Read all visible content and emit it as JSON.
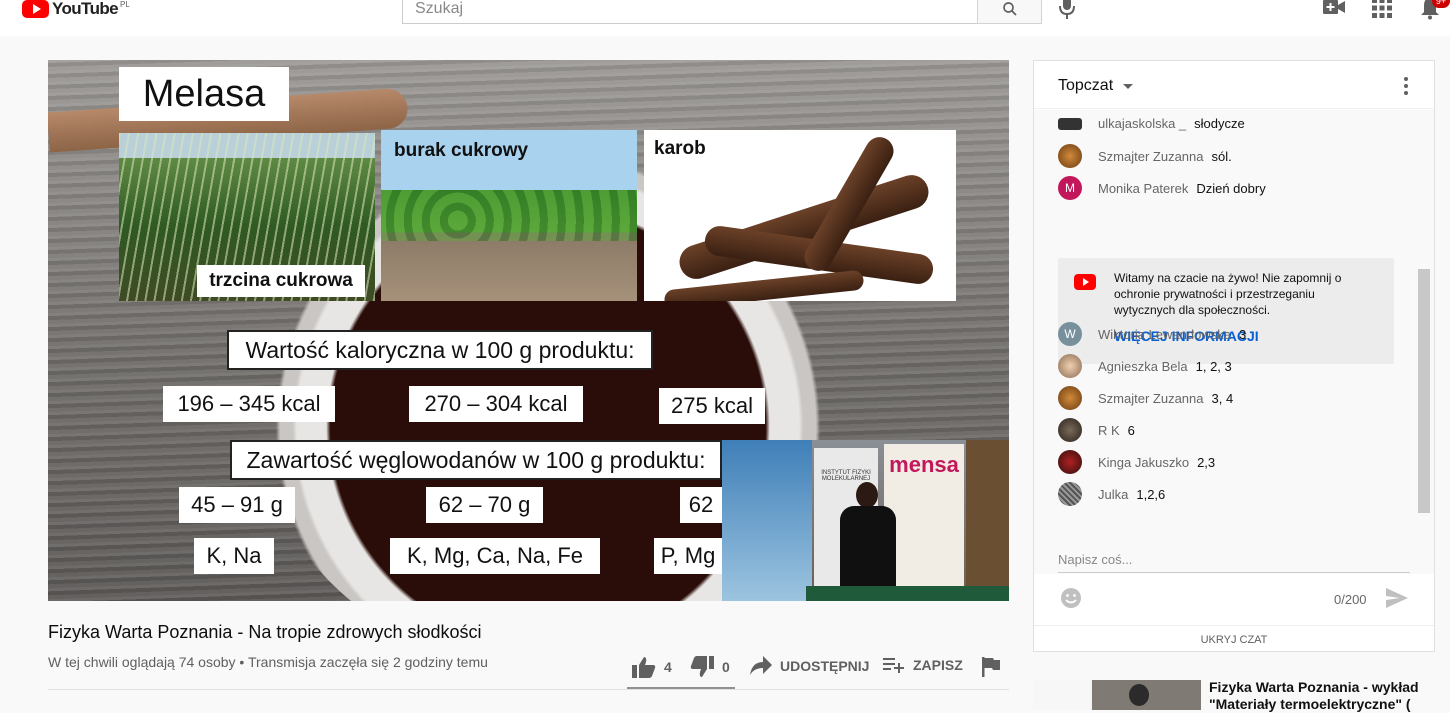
{
  "header": {
    "logo_text": "YouTube",
    "logo_country": "PL",
    "search_placeholder": "Szukaj",
    "notification_count": "9+",
    "accent_color": "#ff0000"
  },
  "video": {
    "slide": {
      "title": "Melasa",
      "photos": [
        {
          "label": "trzcina cukrowa"
        },
        {
          "label": "burak cukrowy"
        },
        {
          "label": "karob"
        }
      ],
      "calorie_heading": "Wartość kaloryczna w 100 g produktu:",
      "calories": [
        "196 – 345 kcal",
        "270 – 304 kcal",
        "275 kcal"
      ],
      "carb_heading": "Zawartość węglowodanów w 100 g produktu:",
      "carbs": [
        "45 – 91 g",
        "62 – 70 g",
        "62"
      ],
      "minerals": [
        "K, Na",
        "K, Mg, Ca, Na, Fe",
        "P, Mg"
      ],
      "inset_banner_left": "INSTYTUT FIZYKI MOLEKULARNEJ",
      "inset_banner_right": "mensa"
    },
    "title": "Fizyka Warta Poznania - Na tropie zdrowych słodkości",
    "meta": "W tej chwili oglądają 74 osoby • Transmisja zaczęła się 2 godziny temu",
    "actions": {
      "likes": "4",
      "dislikes": "0",
      "share": "UDOSTĘPNIJ",
      "save": "ZAPISZ"
    }
  },
  "chat": {
    "title": "Topczat",
    "messages": [
      {
        "author": "ulkajaskolska _",
        "text": "słodycze"
      },
      {
        "author": "Szmajter Zuzanna",
        "text": "sól."
      },
      {
        "author": "Monika Paterek",
        "text": "Dzień dobry",
        "initial": "M"
      },
      {
        "author": "Wiktoria Lewandowska",
        "text": "3",
        "initial": "W"
      },
      {
        "author": "Agnieszka Bela",
        "text": "1, 2, 3"
      },
      {
        "author": "Szmajter Zuzanna",
        "text": "3, 4"
      },
      {
        "author": "R K",
        "text": "6"
      },
      {
        "author": "Kinga Jakuszko",
        "text": "2,3"
      },
      {
        "author": "Julka",
        "text": "1,2,6"
      }
    ],
    "notice": {
      "text": "Witamy na czacie na żywo! Nie zapomnij o ochronie prywatności i przestrzeganiu wytycznych dla społeczności.",
      "link": "WIĘCEJ INFORMACJI"
    },
    "input_placeholder": "Napisz coś...",
    "counter": "0/200",
    "hide_label": "UKRYJ CZAT"
  },
  "related": {
    "title": "Fizyka Warta Poznania - wykład \"Materiały termoelektryczne\" ("
  }
}
